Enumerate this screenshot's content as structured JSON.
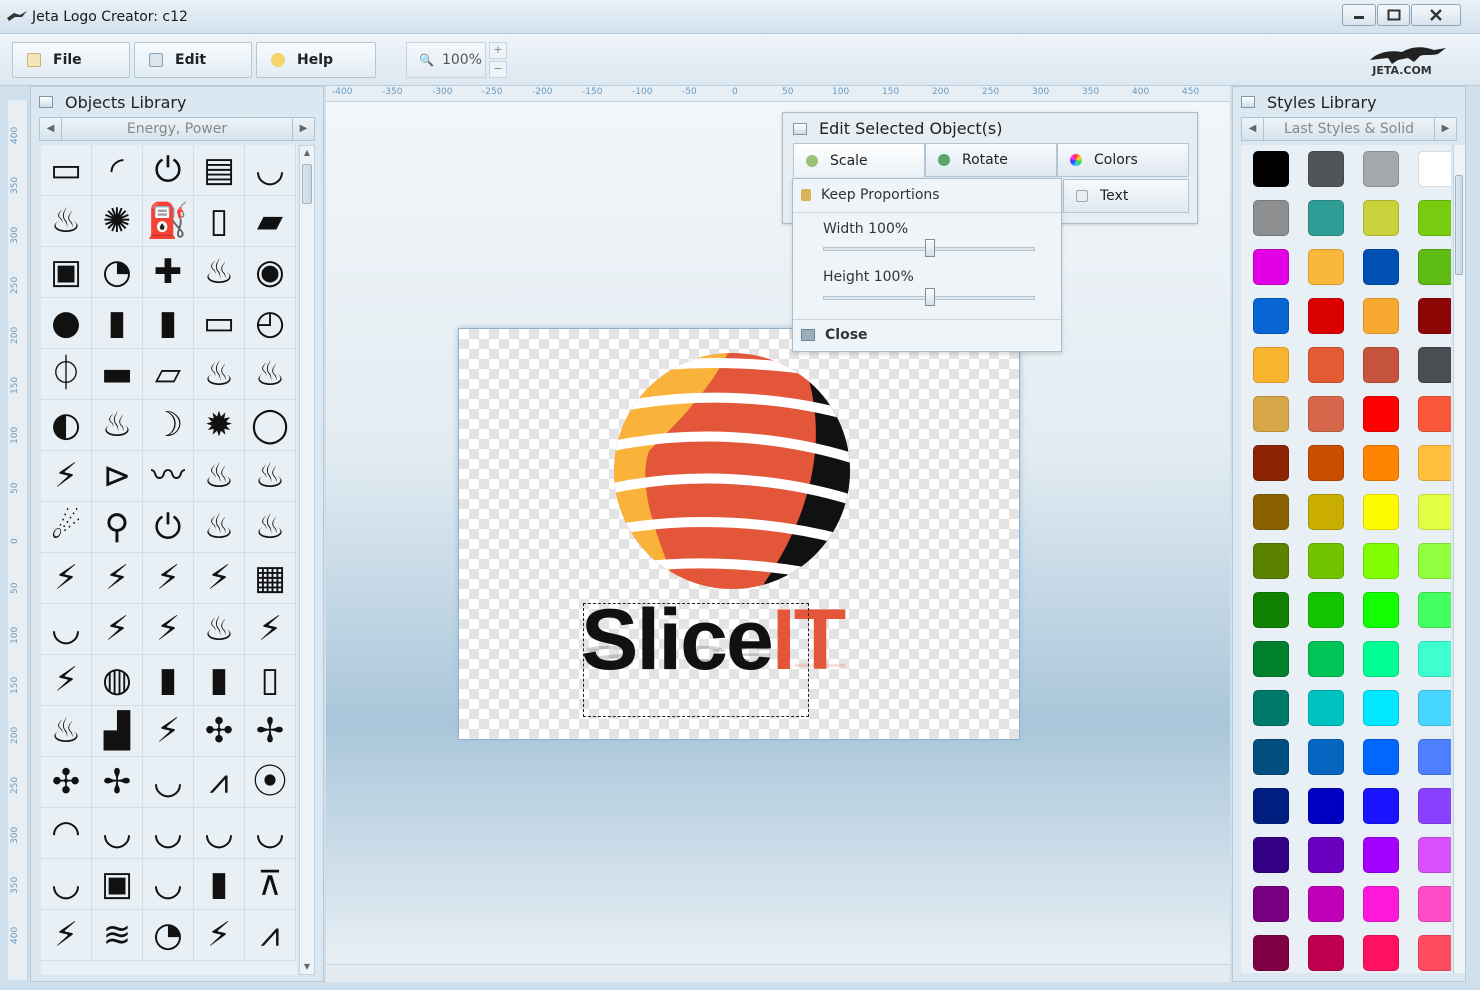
{
  "window": {
    "title": "Jeta Logo Creator: c12"
  },
  "toolbar": {
    "file_label": "File",
    "edit_label": "Edit",
    "help_label": "Help",
    "zoom_value": "100%",
    "zoom_plus": "+",
    "zoom_minus": "−",
    "brand": "JETA.COM"
  },
  "objects_library": {
    "title": "Objects Library",
    "category": "Energy, Power",
    "icons": [
      "battery",
      "wifi-signal",
      "power",
      "battery-full",
      "wifi",
      "flame",
      "lightbulb",
      "fuel-pump",
      "battery-half",
      "usb-battery",
      "battery-charge",
      "rss",
      "plug",
      "fire",
      "broadcast",
      "bulb",
      "battery-high",
      "battery-mid",
      "battery-low",
      "gauge",
      "power-ring",
      "battery-bolt",
      "battery-empty",
      "flame-outline",
      "fire-big",
      "refresh",
      "flames",
      "leaf-bolt",
      "spark",
      "cycle",
      "zap",
      "sign-arrow",
      "wave",
      "flame-tall",
      "flame-twist",
      "fire-ball",
      "bulb-small",
      "power-button",
      "fire-wide",
      "fire-multi",
      "bolt",
      "bolt-thin",
      "bolt-bold",
      "bolt-box",
      "waveform",
      "wifi-small",
      "bolt-2",
      "bolt-3",
      "fire-3",
      "bolt-4",
      "bolt-5",
      "wave-circle",
      "battery-v",
      "battery-v2",
      "battery-v3",
      "flame-drop",
      "factory",
      "bolt-panel",
      "windmill",
      "wind-turbine",
      "wind-farm",
      "turbine",
      "wifi-arc",
      "antenna",
      "location-wifi",
      "signal-dome",
      "wifi-wide",
      "wifi-3",
      "wifi-4",
      "wifi-5",
      "wifi-bold",
      "rss-box",
      "wifi-6",
      "cfl-bulb",
      "tower",
      "bolt-6",
      "stack",
      "speedometer",
      "bolt-7",
      "radio-tower"
    ],
    "glyphs": [
      "▭",
      "◜",
      "⏻",
      "▤",
      "◡",
      "♨",
      "✺",
      "⛽",
      "▯",
      "▰",
      "▣",
      "◔",
      "✚",
      "♨",
      "◉",
      "●",
      "▮",
      "▮",
      "▭",
      "◴",
      "⏀",
      "▬",
      "▱",
      "♨",
      "♨",
      "◐",
      "♨",
      "☽",
      "✹",
      "◯",
      "⚡",
      "⊳",
      "〰",
      "♨",
      "♨",
      "☄",
      "⚲",
      "⏻",
      "♨",
      "♨",
      "⚡",
      "⚡",
      "⚡",
      "⚡",
      "▦",
      "◡",
      "⚡",
      "⚡",
      "♨",
      "⚡",
      "⚡",
      "◍",
      "▮",
      "▮",
      "▯",
      "♨",
      "▟",
      "⚡",
      "✣",
      "✢",
      "✣",
      "✢",
      "◡",
      "⩘",
      "⦿",
      "◠",
      "◡",
      "◡",
      "◡",
      "◡",
      "◡",
      "▣",
      "◡",
      "▮",
      "⊼",
      "⚡",
      "≋",
      "◔",
      "⚡",
      "⩘"
    ]
  },
  "styles_library": {
    "title": "Styles Library",
    "category": "Last Styles & Solid",
    "swatches": [
      "#000000",
      "#505558",
      "#a5a9ac",
      "#ffffff",
      "#8c8e90",
      "#2e9d95",
      "#c9d23a",
      "#77cc10",
      "#e100e6",
      "#f9b83a",
      "#0050b3",
      "#5dbb12",
      "#0766d2",
      "#d80000",
      "#f8aa30",
      "#8c0606",
      "#f9b42f",
      "#e35b34",
      "#c6543a",
      "#4a4e52",
      "#d7a84a",
      "#d5664a",
      "#ff0000",
      "#fa5638",
      "#8d2403",
      "#cb4d00",
      "#ff8400",
      "#ffbf3d",
      "#8a6300",
      "#c9ad00",
      "#fffb00",
      "#e2ff43",
      "#5c8200",
      "#72c400",
      "#82ff00",
      "#90ff3f",
      "#108000",
      "#12c400",
      "#11ff00",
      "#44ff60",
      "#007f2c",
      "#00c457",
      "#00ff93",
      "#3dffd0",
      "#007a68",
      "#00c2c0",
      "#00e8ff",
      "#47d6ff",
      "#034e80",
      "#0466c0",
      "#0068ff",
      "#4d7fff",
      "#001d80",
      "#0000c2",
      "#1a13ff",
      "#8a41ff",
      "#330083",
      "#6a00c0",
      "#a400ff",
      "#d951ff",
      "#780080",
      "#c000b8",
      "#ff19d8",
      "#ff4cc9",
      "#800046",
      "#c0004f",
      "#ff1060",
      "#ff4b60"
    ]
  },
  "rulers": {
    "horizontal": [
      "-400",
      "-350",
      "-300",
      "-250",
      "-200",
      "-150",
      "-100",
      "-50",
      "0",
      "50",
      "100",
      "150",
      "200",
      "250",
      "300",
      "350",
      "400",
      "450"
    ],
    "vertical": [
      "400",
      "350",
      "300",
      "250",
      "200",
      "150",
      "100",
      "50",
      "0",
      "50",
      "100",
      "150",
      "200",
      "250",
      "300",
      "350",
      "400"
    ]
  },
  "edit_panel": {
    "title": "Edit Selected Object(s)",
    "tab_scale": "Scale",
    "tab_rotate": "Rotate",
    "tab_colors": "Colors",
    "tab_text": "Text",
    "keep_proportions": "Keep Proportions",
    "width_label": "Width 100%",
    "height_label": "Height 100%",
    "width_value": 0.5,
    "height_value": 0.5,
    "close_label": "Close"
  },
  "canvas": {
    "logo_word_1": "Slice",
    "logo_word_2": "IT",
    "colors": {
      "orange": "#e3563a",
      "amber": "#f9b33b",
      "dark": "#111111"
    }
  }
}
